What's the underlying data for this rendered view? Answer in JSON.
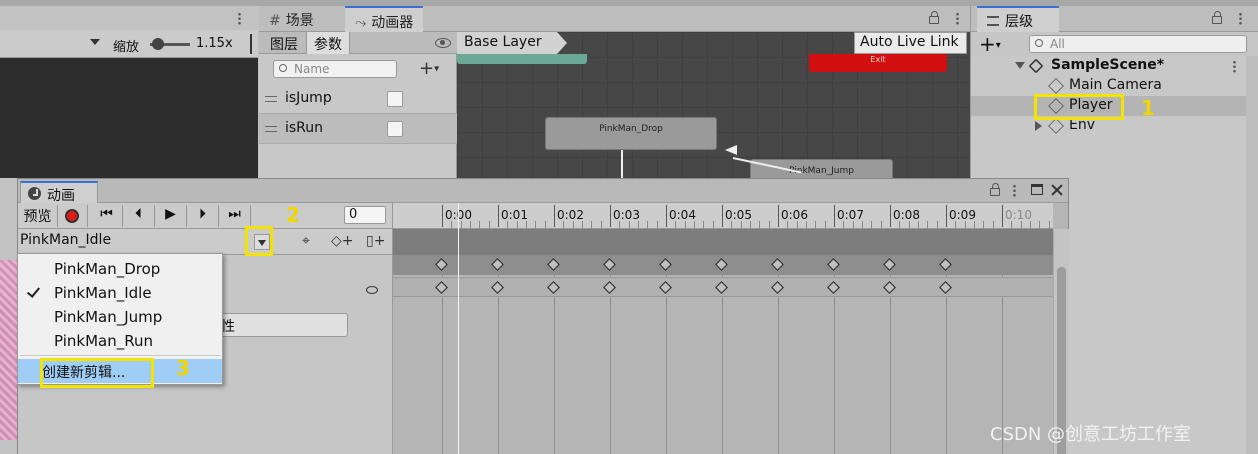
{
  "scene_toolbar": {
    "zoom_label": "缩放",
    "zoom_value": "1.15x"
  },
  "center_tabs": [
    {
      "label": "场景",
      "icon": "hash-icon"
    },
    {
      "label": "动画器",
      "icon": "animator-icon"
    }
  ],
  "animator": {
    "subtabs": [
      "图层",
      "参数"
    ],
    "search_placeholder": "Name",
    "params": [
      {
        "name": "isJump"
      },
      {
        "name": "isRun"
      }
    ],
    "breadcrumb": "Base Layer",
    "auto_live_link": "Auto Live Link",
    "states": [
      "PinkMan_Drop",
      "PinkMan_Jump",
      "Exit"
    ]
  },
  "hierarchy": {
    "tab_label": "层级",
    "search_placeholder": "All",
    "scene": "SampleScene*",
    "items": [
      "Main Camera",
      "Player",
      "Env"
    ]
  },
  "animation": {
    "tab_label": "动画",
    "preview_label": "预览",
    "frame_value": "0",
    "current_clip": "PinkMan_Idle",
    "clip_options": [
      "PinkMan_Drop",
      "PinkMan_Idle",
      "PinkMan_Jump",
      "PinkMan_Run"
    ],
    "selected_clip_index": 1,
    "create_new_clip": "创建新剪辑...",
    "add_property_partial": "性",
    "ticks": [
      "0:00",
      "0:01",
      "0:02",
      "0:03",
      "0:04",
      "0:05",
      "0:06",
      "0:07",
      "0:08",
      "0:09",
      "0:10"
    ]
  },
  "annotations": [
    "1",
    "2",
    "3"
  ],
  "watermark": "CSDN @创意工坊工作室",
  "colors": {
    "highlight": "#f3e400",
    "selection": "#9fcdf5",
    "record": "#e01b1b",
    "accent": "#3a72d1"
  }
}
